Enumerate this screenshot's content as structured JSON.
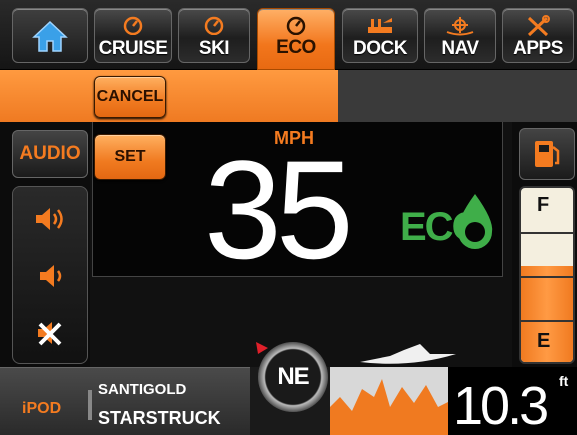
{
  "top_nav": {
    "home": {
      "icon": "home-icon"
    },
    "cruise": {
      "label": "CRUISE",
      "icon": "gauge-icon"
    },
    "ski": {
      "label": "SKI",
      "icon": "gauge-icon"
    },
    "eco": {
      "label": "ECO",
      "icon": "gauge-icon"
    },
    "dock": {
      "label": "DOCK",
      "icon": "dock-icon"
    },
    "nav": {
      "label": "NAV",
      "icon": "boat-helm-icon"
    },
    "apps": {
      "label": "APPS",
      "icon": "tools-icon"
    }
  },
  "eco_menu": {
    "cancel_label": "CANCEL",
    "set_label": "SET"
  },
  "audio": {
    "label": "AUDIO"
  },
  "speed": {
    "value": "35",
    "unit": "MPH",
    "mode_logo": "ECO"
  },
  "fuel": {
    "full_label": "F",
    "empty_label": "E",
    "level": 0.55,
    "icon": "fuel-pump-icon"
  },
  "media": {
    "source": "iPOD",
    "artist": "SANTIGOLD",
    "track": "STARSTRUCK"
  },
  "compass": {
    "heading": "NE"
  },
  "depth": {
    "value": "10.3",
    "unit": "ft"
  },
  "colors": {
    "accent": "#f47b20",
    "eco_green": "#3fae49",
    "panel": "#1b1b1b"
  }
}
